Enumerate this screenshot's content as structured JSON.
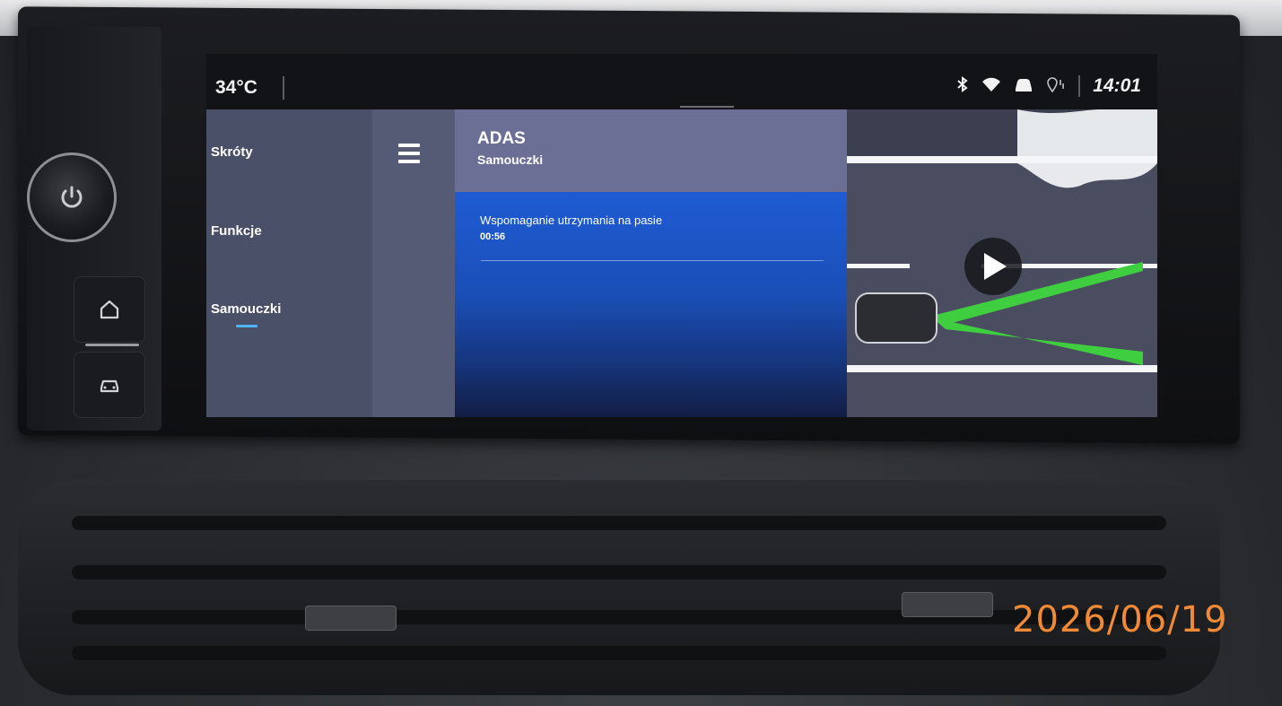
{
  "status_bar": {
    "temperature": "34°C",
    "time": "14:01",
    "icons": [
      "bluetooth-icon",
      "wifi-icon",
      "car-icon",
      "location-icon"
    ]
  },
  "sidebar": {
    "items": [
      {
        "label": "Skróty"
      },
      {
        "label": "Funkcje"
      },
      {
        "label": "Samouczki",
        "active": true
      }
    ]
  },
  "header": {
    "title": "ADAS",
    "subtitle": "Samouczki"
  },
  "tutorial": {
    "title": "Wspomaganie utrzymania na pasie",
    "duration": "00:56"
  },
  "hardware": {
    "buttons": [
      "power-icon",
      "home-icon",
      "car-icon"
    ]
  },
  "photo_stamp": "2026/06/19",
  "colors": {
    "sidebar": "#4b5069",
    "accent": "#4fb4ff",
    "content_gradient_top": "#1f5bd3",
    "lane_assist_green": "#3fce3f",
    "stamp": "#f08a36"
  }
}
